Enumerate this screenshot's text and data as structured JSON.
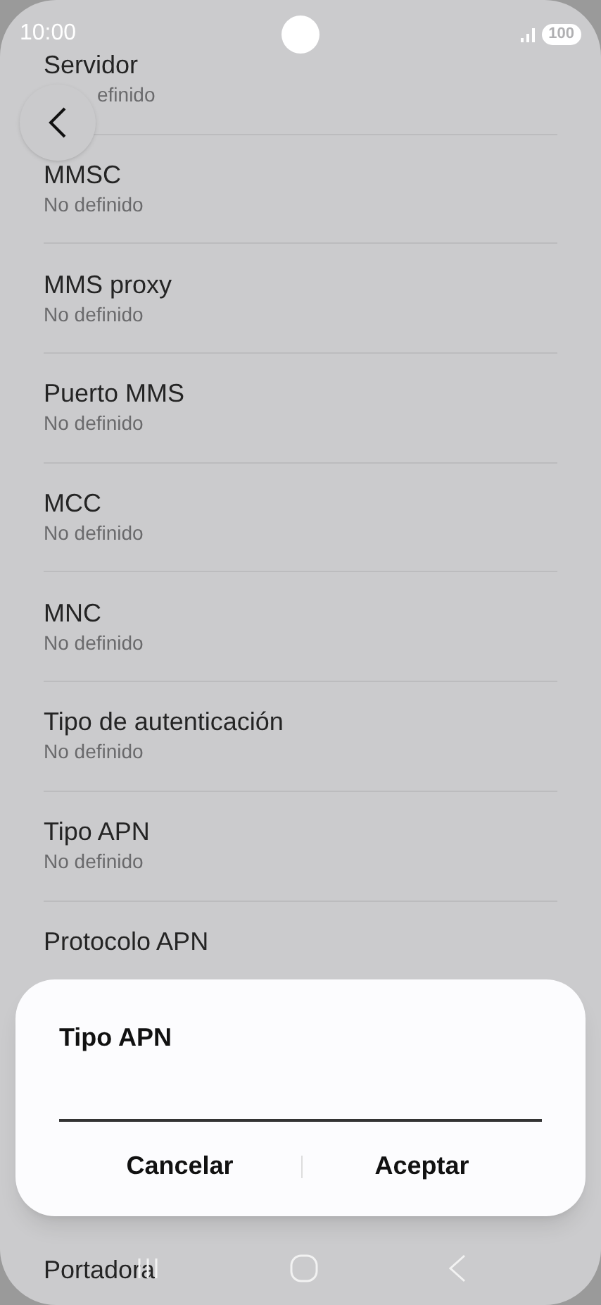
{
  "status_bar": {
    "time": "10:00",
    "battery": "100"
  },
  "settings": [
    {
      "title": "Servidor",
      "value": "efinido"
    },
    {
      "title": "MMSC",
      "value": "No definido"
    },
    {
      "title": "MMS proxy",
      "value": "No definido"
    },
    {
      "title": "Puerto MMS",
      "value": "No definido"
    },
    {
      "title": "MCC",
      "value": "No definido"
    },
    {
      "title": "MNC",
      "value": "No definido"
    },
    {
      "title": "Tipo de autenticación",
      "value": "No definido"
    },
    {
      "title": "Tipo APN",
      "value": "No definido"
    },
    {
      "title": "Protocolo APN"
    }
  ],
  "below_dialog": [
    {
      "title": "Portadora"
    }
  ],
  "dialog": {
    "title": "Tipo APN",
    "buttons": [
      "Cancelar",
      "Aceptar"
    ]
  }
}
